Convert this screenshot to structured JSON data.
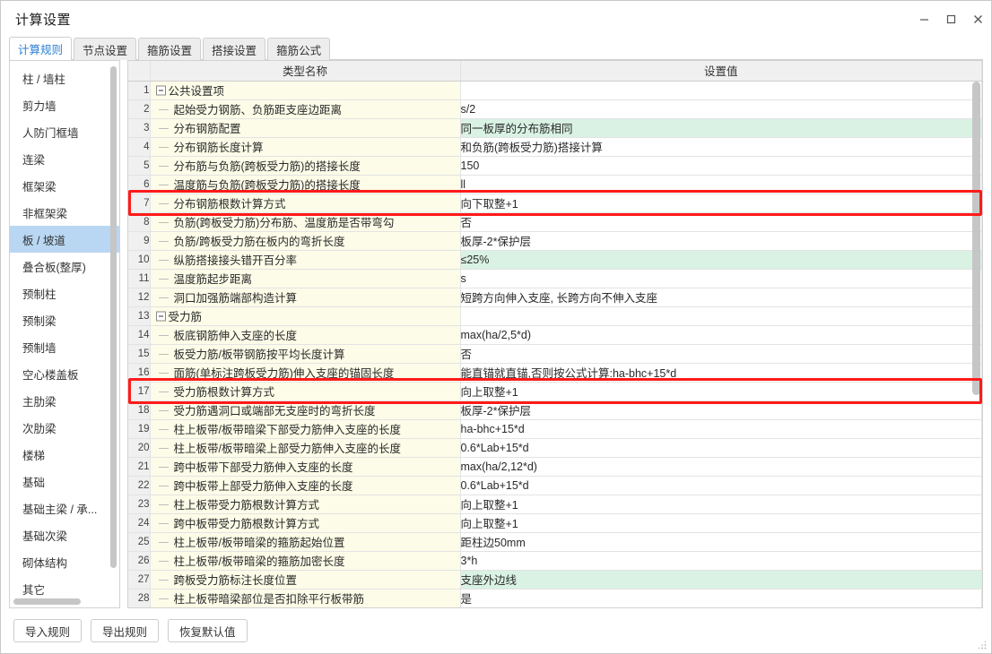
{
  "window": {
    "title": "计算设置",
    "controls": [
      {
        "name": "minimize-button",
        "glyph": "minimize"
      },
      {
        "name": "maximize-button",
        "glyph": "maximize"
      },
      {
        "name": "close-button",
        "glyph": "close"
      }
    ]
  },
  "tabs": [
    {
      "label": "计算规则",
      "active": true
    },
    {
      "label": "节点设置",
      "active": false
    },
    {
      "label": "箍筋设置",
      "active": false
    },
    {
      "label": "搭接设置",
      "active": false
    },
    {
      "label": "箍筋公式",
      "active": false
    }
  ],
  "sidebar": {
    "selected": "板 / 坡道",
    "items": [
      {
        "label": "柱 / 墙柱"
      },
      {
        "label": "剪力墙"
      },
      {
        "label": "人防门框墙"
      },
      {
        "label": "连梁"
      },
      {
        "label": "框架梁"
      },
      {
        "label": "非框架梁"
      },
      {
        "label": "板 / 坡道"
      },
      {
        "label": "叠合板(整厚)"
      },
      {
        "label": "预制柱"
      },
      {
        "label": "预制梁"
      },
      {
        "label": "预制墙"
      },
      {
        "label": "空心楼盖板"
      },
      {
        "label": "主肋梁"
      },
      {
        "label": "次肋梁"
      },
      {
        "label": "楼梯"
      },
      {
        "label": "基础"
      },
      {
        "label": "基础主梁 / 承..."
      },
      {
        "label": "基础次梁"
      },
      {
        "label": "砌体结构"
      },
      {
        "label": "其它"
      }
    ]
  },
  "table": {
    "headers": {
      "num": "",
      "name": "类型名称",
      "value": "设置值"
    },
    "rows": [
      {
        "num": "1",
        "name": "公共设置项",
        "value": "",
        "group": true,
        "modified": false
      },
      {
        "num": "2",
        "name": "起始受力钢筋、负筋距支座边距离",
        "value": "s/2",
        "group": false,
        "modified": false
      },
      {
        "num": "3",
        "name": "分布钢筋配置",
        "value": "同一板厚的分布筋相同",
        "group": false,
        "modified": true
      },
      {
        "num": "4",
        "name": "分布钢筋长度计算",
        "value": "和负筋(跨板受力筋)搭接计算",
        "group": false,
        "modified": false
      },
      {
        "num": "5",
        "name": "分布筋与负筋(跨板受力筋)的搭接长度",
        "value": "150",
        "group": false,
        "modified": false
      },
      {
        "num": "6",
        "name": "温度筋与负筋(跨板受力筋)的搭接长度",
        "value": "ll",
        "group": false,
        "modified": false
      },
      {
        "num": "7",
        "name": "分布钢筋根数计算方式",
        "value": "向下取整+1",
        "group": false,
        "modified": false,
        "highlight": true
      },
      {
        "num": "8",
        "name": "负筋(跨板受力筋)分布筋、温度筋是否带弯勾",
        "value": "否",
        "group": false,
        "modified": false
      },
      {
        "num": "9",
        "name": "负筋/跨板受力筋在板内的弯折长度",
        "value": "板厚-2*保护层",
        "group": false,
        "modified": false
      },
      {
        "num": "10",
        "name": "纵筋搭接接头错开百分率",
        "value": "≤25%",
        "group": false,
        "modified": true
      },
      {
        "num": "11",
        "name": "温度筋起步距离",
        "value": "s",
        "group": false,
        "modified": false
      },
      {
        "num": "12",
        "name": "洞口加强筋端部构造计算",
        "value": "短跨方向伸入支座, 长跨方向不伸入支座",
        "group": false,
        "modified": false
      },
      {
        "num": "13",
        "name": "受力筋",
        "value": "",
        "group": true,
        "modified": false
      },
      {
        "num": "14",
        "name": "板底钢筋伸入支座的长度",
        "value": "max(ha/2,5*d)",
        "group": false,
        "modified": false
      },
      {
        "num": "15",
        "name": "板受力筋/板带钢筋按平均长度计算",
        "value": "否",
        "group": false,
        "modified": false
      },
      {
        "num": "16",
        "name": "面筋(单标注跨板受力筋)伸入支座的锚固长度",
        "value": "能直锚就直锚,否则按公式计算:ha-bhc+15*d",
        "group": false,
        "modified": false
      },
      {
        "num": "17",
        "name": "受力筋根数计算方式",
        "value": "向上取整+1",
        "group": false,
        "modified": false,
        "highlight": true
      },
      {
        "num": "18",
        "name": "受力筋遇洞口或端部无支座时的弯折长度",
        "value": "板厚-2*保护层",
        "group": false,
        "modified": false
      },
      {
        "num": "19",
        "name": "柱上板带/板带暗梁下部受力筋伸入支座的长度",
        "value": "ha-bhc+15*d",
        "group": false,
        "modified": false
      },
      {
        "num": "20",
        "name": "柱上板带/板带暗梁上部受力筋伸入支座的长度",
        "value": "0.6*Lab+15*d",
        "group": false,
        "modified": false
      },
      {
        "num": "21",
        "name": "跨中板带下部受力筋伸入支座的长度",
        "value": "max(ha/2,12*d)",
        "group": false,
        "modified": false
      },
      {
        "num": "22",
        "name": "跨中板带上部受力筋伸入支座的长度",
        "value": "0.6*Lab+15*d",
        "group": false,
        "modified": false
      },
      {
        "num": "23",
        "name": "柱上板带受力筋根数计算方式",
        "value": "向上取整+1",
        "group": false,
        "modified": false
      },
      {
        "num": "24",
        "name": "跨中板带受力筋根数计算方式",
        "value": "向上取整+1",
        "group": false,
        "modified": false
      },
      {
        "num": "25",
        "name": "柱上板带/板带暗梁的箍筋起始位置",
        "value": "距柱边50mm",
        "group": false,
        "modified": false
      },
      {
        "num": "26",
        "name": "柱上板带/板带暗梁的箍筋加密长度",
        "value": "3*h",
        "group": false,
        "modified": false
      },
      {
        "num": "27",
        "name": "跨板受力筋标注长度位置",
        "value": "支座外边线",
        "group": false,
        "modified": true
      },
      {
        "num": "28",
        "name": "柱上板带暗梁部位是否扣除平行板带筋",
        "value": "是",
        "group": false,
        "modified": false
      }
    ]
  },
  "footer": {
    "buttons": [
      {
        "label": "导入规则",
        "name": "import-rules-button"
      },
      {
        "label": "导出规则",
        "name": "export-rules-button"
      },
      {
        "label": "恢复默认值",
        "name": "restore-defaults-button"
      }
    ]
  },
  "colors": {
    "accent": "#2a7fd4",
    "selection": "#b9d7f2",
    "name_cell": "#fcfce8",
    "modified_cell": "#d9f2e4",
    "highlight_border": "#ff1a1a",
    "header_bg": "#f0f0f0"
  }
}
